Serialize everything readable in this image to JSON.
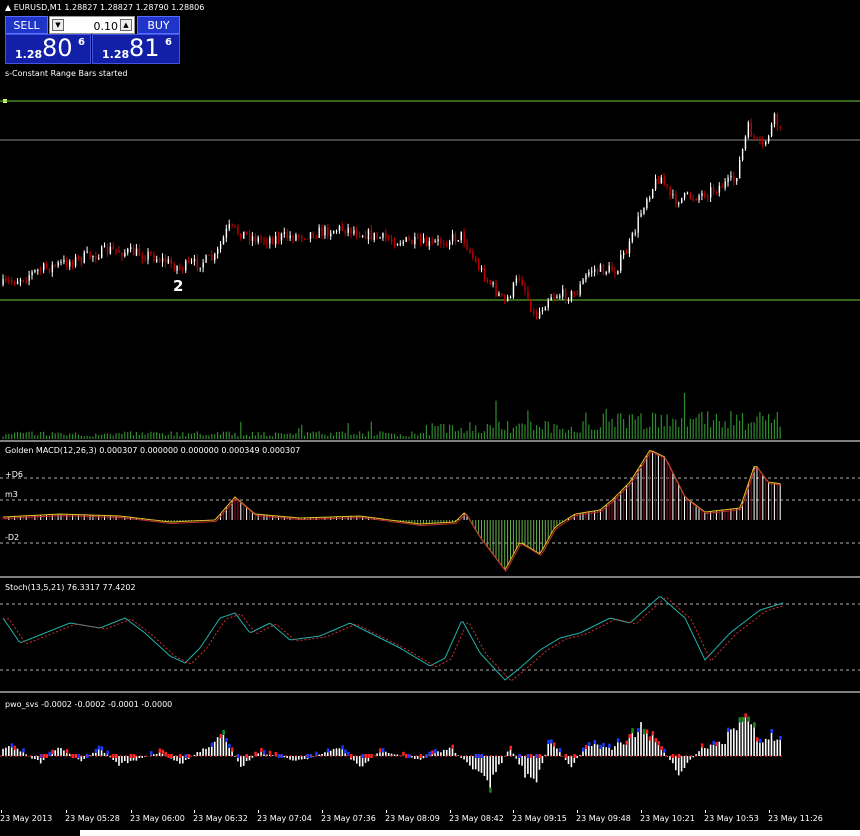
{
  "header": {
    "symbol_line": "EURUSD,M1  1.28827 1.28827 1.28790 1.28806",
    "status_line": "s-Constant Range Bars started"
  },
  "trade_panel": {
    "sell_label": "SELL",
    "buy_label": "BUY",
    "lot_value": "0.10",
    "sell_quote": {
      "small": "1.28",
      "big": "80",
      "sup": "6"
    },
    "buy_quote": {
      "small": "1.28",
      "big": "81",
      "sup": "6"
    }
  },
  "main_chart": {
    "marker_label": "2",
    "colors": {
      "bull": "#ffffff",
      "bear": "#c00000",
      "level": "#66cc33",
      "price_line": "#8a8a8a",
      "volume": "#2e8b2e"
    }
  },
  "macd_pane": {
    "title": "Golden MACD(12,26,3) 0.000307 0.000000 0.000000 0.000349 0.000307",
    "levels": [
      "+D6",
      "m3",
      "-D2"
    ]
  },
  "stoch_pane": {
    "title": "Stoch(13,5,21) 76.3317 77.4202"
  },
  "pwo_pane": {
    "title": "pwo_svs -0.0002 -0.0002 -0.0001 -0.0000"
  },
  "x_axis": {
    "ticks": [
      "23 May 2013",
      "23 May 05:28",
      "23 May 06:00",
      "23 May 06:32",
      "23 May 07:04",
      "23 May 07:36",
      "23 May 08:09",
      "23 May 08:42",
      "23 May 09:15",
      "23 May 09:48",
      "23 May 10:21",
      "23 May 10:53",
      "23 May 11:26"
    ]
  }
}
